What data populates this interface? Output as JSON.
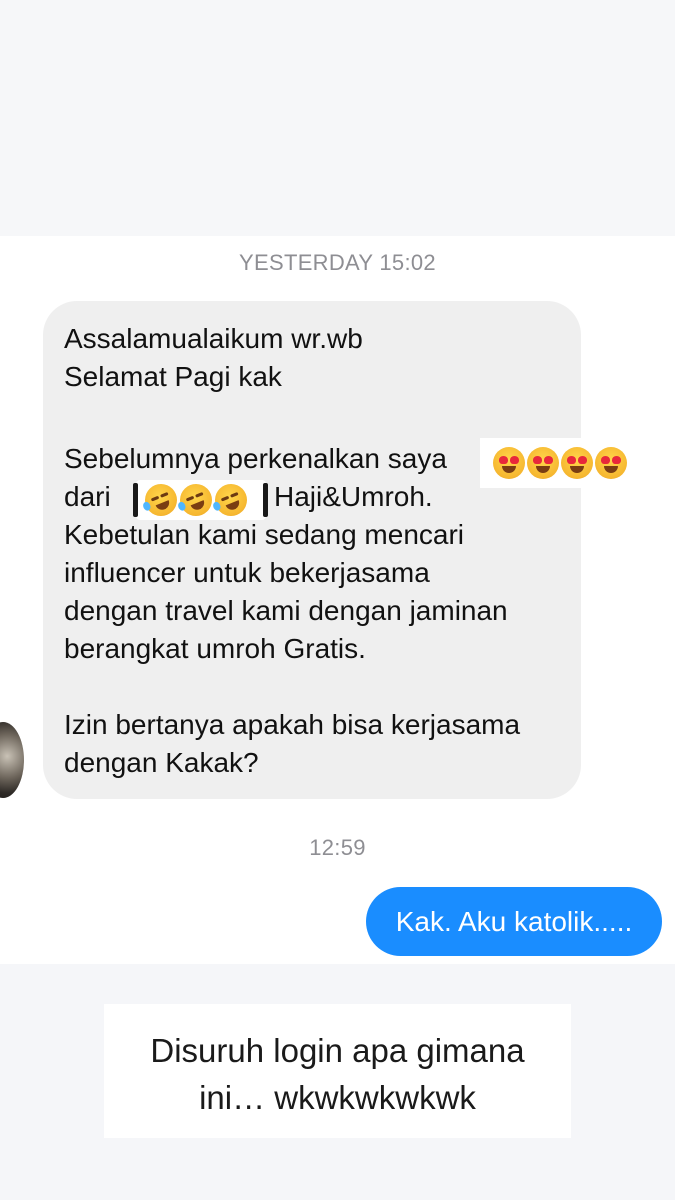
{
  "chat": {
    "timestamp_1": "YESTERDAY 15:02",
    "incoming_message": {
      "lines": [
        "Assalamualaikum wr.wb",
        "Selamat Pagi kak",
        "",
        "Sebelumnya perkenalkan saya",
        "dari",
        "Haji&Umroh.",
        "Kebetulan kami sedang mencari",
        "influencer untuk bekerjasama",
        "dengan travel kami dengan jaminan",
        "berangkat umroh Gratis.",
        "",
        "Izin bertanya apakah bisa kerjasama",
        "dengan Kakak?"
      ]
    },
    "timestamp_2": "12:59",
    "outgoing_message": "Kak. Aku katolik....."
  },
  "overlay": {
    "emoji_heart_eyes": "smiling-face-with-heart-eyes-icon",
    "emoji_laughing": "rolling-on-the-floor-laughing-icon"
  },
  "caption": {
    "line_1": "Disuruh login apa gimana",
    "line_2": "ini… wkwkwkwkwk"
  }
}
